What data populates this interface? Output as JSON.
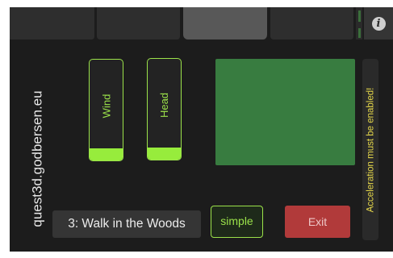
{
  "header": {
    "tabs": [
      {
        "label": ""
      },
      {
        "label": ""
      },
      {
        "label": ""
      },
      {
        "label": ""
      }
    ],
    "info_icon": "info-icon"
  },
  "sidebar": {
    "site_url": "quest3d.godbersen.eu"
  },
  "controls": {
    "wind": {
      "label": "Wind",
      "level_percent": 12
    },
    "head": {
      "label": "Head",
      "level_percent": 12
    }
  },
  "warning": {
    "text": "Acceleration must be enabled!"
  },
  "footer": {
    "level_name": "3: Walk in the Woods",
    "simple_label": "simple",
    "exit_label": "Exit"
  },
  "colors": {
    "accent_green": "#97ec3c",
    "pad_green": "#387c40",
    "exit_red": "#b13a3a",
    "warning_yellow": "#e6d84a",
    "background": "#1c1c1c"
  }
}
